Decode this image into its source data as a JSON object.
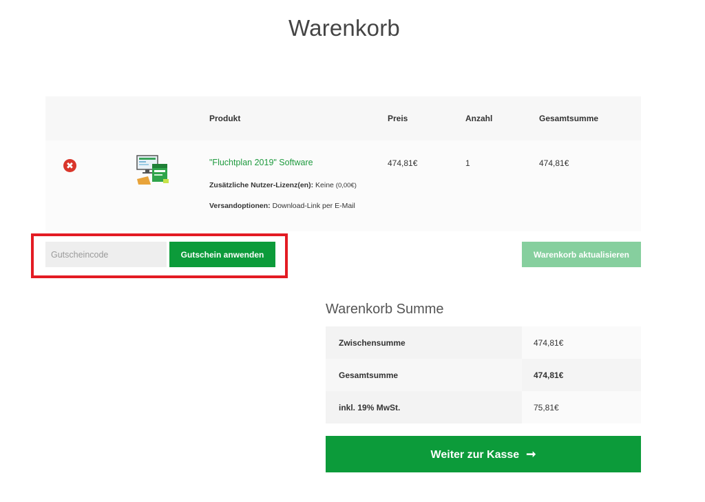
{
  "page": {
    "title": "Warenkorb"
  },
  "cart": {
    "headers": {
      "product": "Produkt",
      "price": "Preis",
      "qty": "Anzahl",
      "total": "Gesamtsumme"
    },
    "remove_icon": "✖",
    "items": [
      {
        "name": "\"Fluchtplan 2019\" Software",
        "license_label": "Zusätzliche Nutzer-Lizenz(en):",
        "license_value": "Keine",
        "license_price": "(0,00€)",
        "shipping_label": "Versandoptionen:",
        "shipping_value": "Download-Link per E-Mail",
        "price": "474,81€",
        "qty": "1",
        "total": "474,81€"
      }
    ]
  },
  "coupon": {
    "placeholder": "Gutscheincode",
    "apply_label": "Gutschein anwenden"
  },
  "update_label": "Warenkorb aktualisieren",
  "totals": {
    "title": "Warenkorb Summe",
    "rows": [
      {
        "label": "Zwischensumme",
        "value": "474,81€"
      },
      {
        "label": "Gesamtsumme",
        "value": "474,81€"
      },
      {
        "label": "inkl. 19% MwSt.",
        "value": "75,81€"
      }
    ]
  },
  "checkout": {
    "label": "Weiter zur Kasse",
    "arrow": "➞"
  },
  "colors": {
    "brand_green": "#0c9b3a",
    "link_green": "#1e9a3e",
    "highlight_red": "#e31b23",
    "remove_red": "#d9362b"
  }
}
